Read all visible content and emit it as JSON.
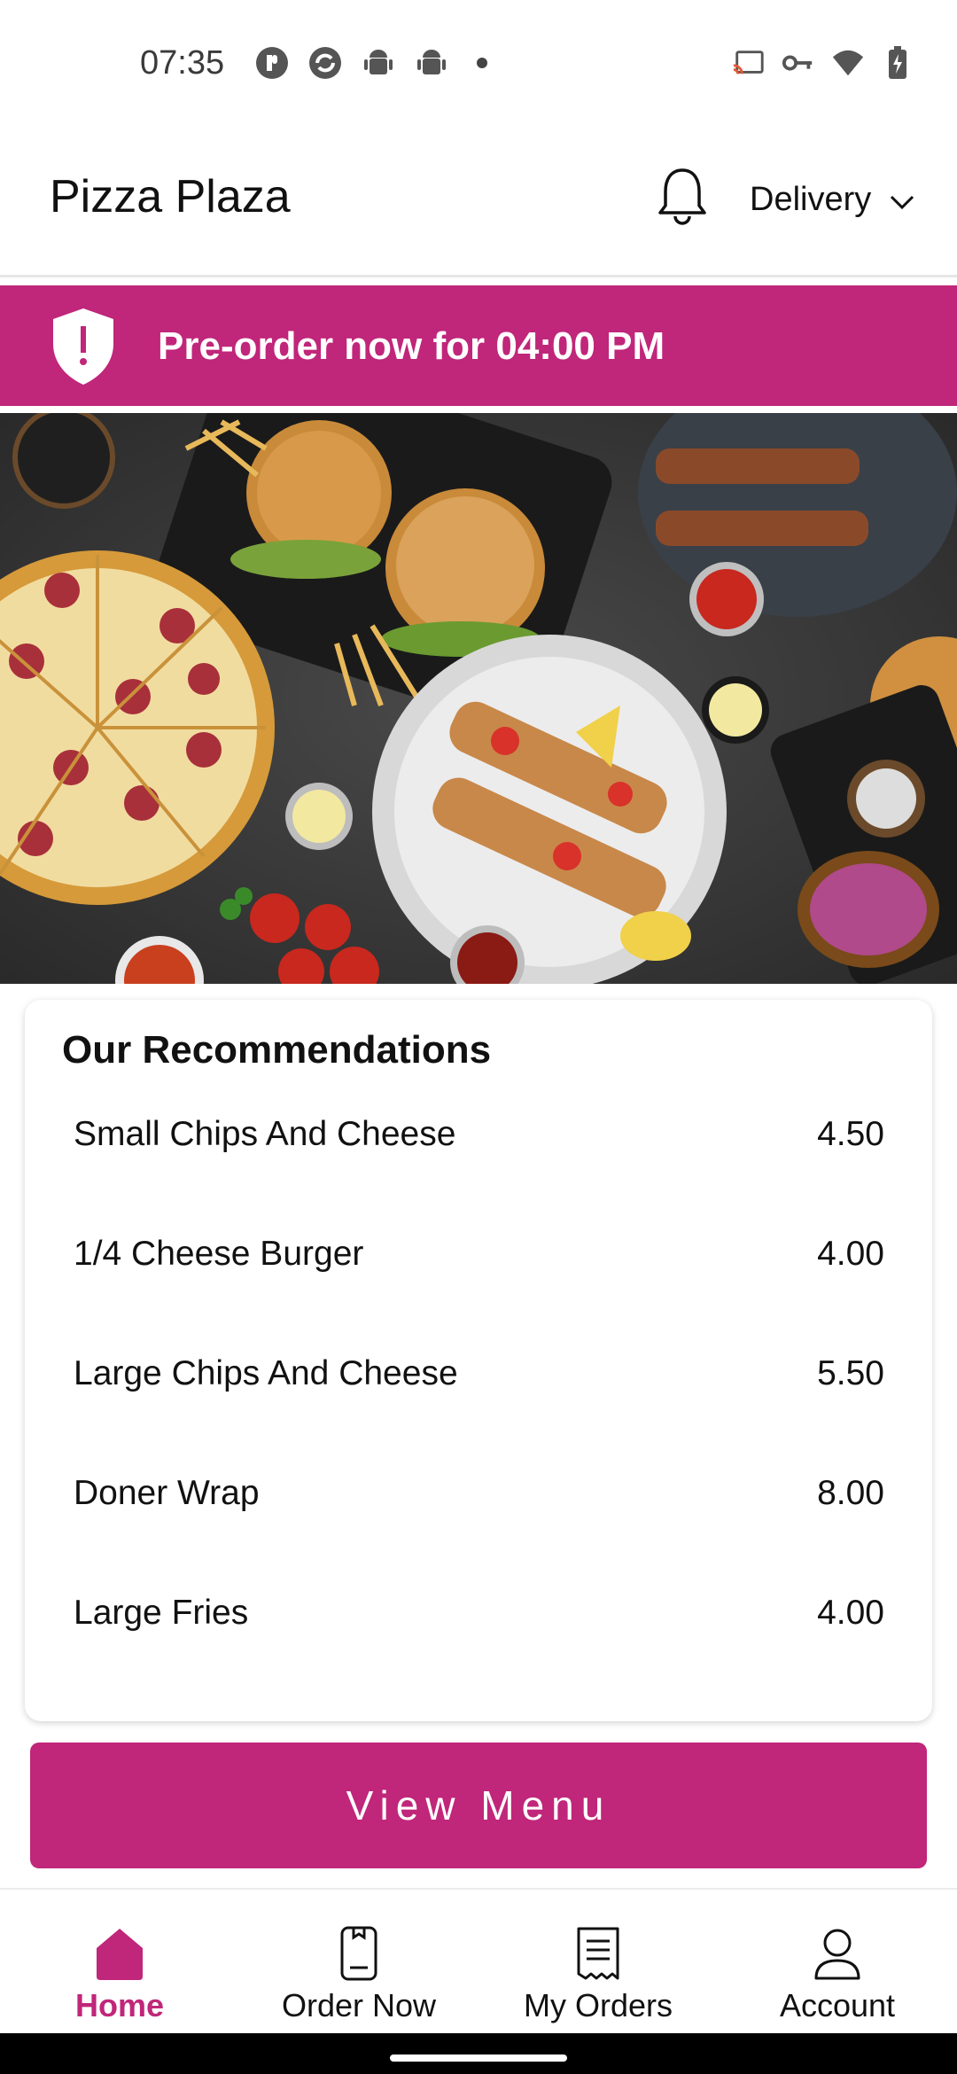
{
  "status_bar": {
    "time": "07:35",
    "left_icons": [
      "app-p-icon",
      "sync-app-icon",
      "android-icon",
      "android-icon",
      "dot-icon"
    ],
    "right_icons": [
      "cast-icon",
      "vpn-key-icon",
      "wifi-icon",
      "battery-charging-icon"
    ]
  },
  "header": {
    "title": "Pizza Plaza",
    "notification_icon": "bell-icon",
    "delivery_label": "Delivery"
  },
  "banner": {
    "text": "Pre-order now for 04:00 PM",
    "icon": "shield-alert-icon",
    "color": "#c0267a"
  },
  "recommendations": {
    "title": "Our Recommendations",
    "items": [
      {
        "name": "Small Chips And Cheese",
        "price": "4.50"
      },
      {
        "name": "1/4 Cheese Burger",
        "price": "4.00"
      },
      {
        "name": "Large Chips And Cheese",
        "price": "5.50"
      },
      {
        "name": "Doner Wrap",
        "price": "8.00"
      },
      {
        "name": "Large Fries",
        "price": "4.00"
      }
    ]
  },
  "view_menu_label": "View Menu",
  "bottom_nav": {
    "items": [
      {
        "label": "Home",
        "icon": "home-icon",
        "active": true
      },
      {
        "label": "Order Now",
        "icon": "order-phone-icon",
        "active": false
      },
      {
        "label": "My Orders",
        "icon": "receipt-icon",
        "active": false
      },
      {
        "label": "Account",
        "icon": "user-icon",
        "active": false
      }
    ]
  },
  "colors": {
    "accent": "#c0267a"
  }
}
